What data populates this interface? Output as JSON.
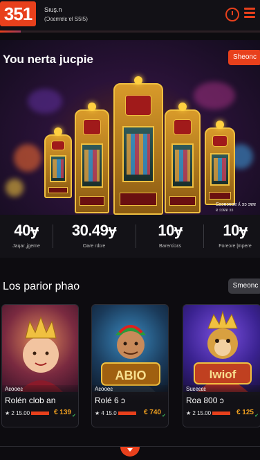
{
  "header": {
    "logo_text": "351",
    "brand_line1": "Sıuş.n",
    "brand_line2": "(Ɔoɛmɐlɛ ɐl S5I5)",
    "progress_fraction": 0.08,
    "accent_color": "#e8401c",
    "icons": [
      "clock-icon",
      "menu-icon"
    ]
  },
  "hero": {
    "title": "You nerta jucpie",
    "cta_label": "Sheonc",
    "caption_line1": "Sɔɔɐɔɐɔɐ ʎ ɔɔ ɔɐɐ",
    "caption_line2": "ɐ ɔɔɐɐ ɔɔ"
  },
  "stats": [
    {
      "value": "40ɏ",
      "label": "Jaɥaɾ ʝgeme"
    },
    {
      "value": "30.49ɏ",
      "label": "Oaɾe ɾdɪɾe"
    },
    {
      "value": "10ɏ",
      "label": "Baɾeɾɛiɔɛs"
    },
    {
      "value": "10ɏ",
      "label": "Foɾeɔɾe ɭmpeɾe"
    }
  ],
  "section": {
    "title": "Los parior phao",
    "button_label": "Smeonc"
  },
  "cards": [
    {
      "tag": "Aɛooeɛ",
      "name": "Rolén clob an",
      "meta": "★ 2 15.00",
      "price": "€ 139",
      "art": "queen"
    },
    {
      "tag": "Aɛooeɛ",
      "name": "Rolé 6 ɔ",
      "meta": "★ 4 15.0",
      "price": "€ 740",
      "art": "warrior",
      "art_text": "ABIO"
    },
    {
      "tag": "Suɛeɛɛɛ",
      "name": "Roa 800 ɔ",
      "meta": "★ 2 15.00",
      "price": "€ 125",
      "art": "monkey",
      "art_text": "Iwiof"
    }
  ]
}
